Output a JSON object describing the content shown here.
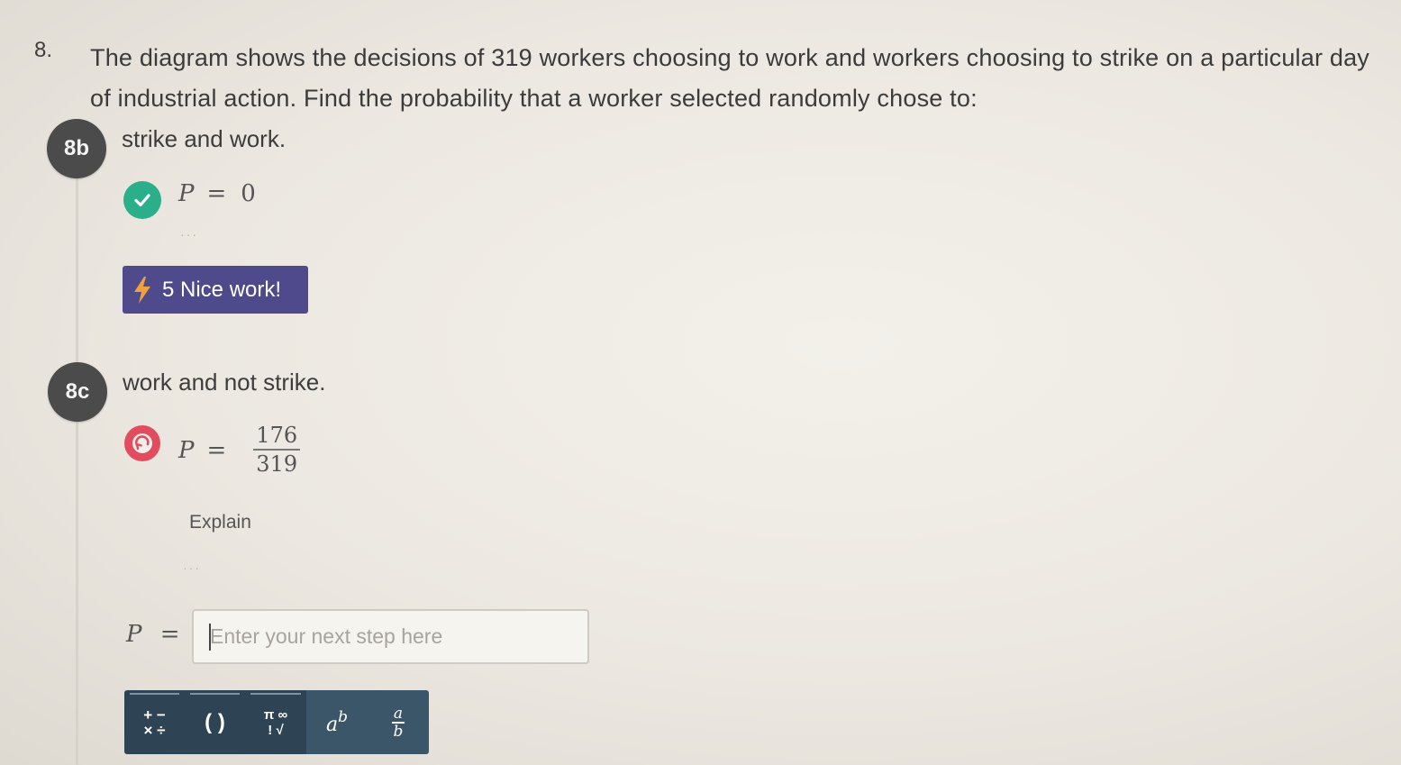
{
  "question": {
    "number": "8.",
    "text": "The diagram shows the decisions of 319 workers choosing to work and workers choosing to strike on a particular day of industrial action. Find the probability that a worker selected randomly chose to:"
  },
  "part_b": {
    "badge": "8b",
    "prompt": "strike and work.",
    "answer_var": "P",
    "answer_eq": "=",
    "answer_value": "0",
    "status_icon": "check-icon",
    "more_dots": "···",
    "reward": {
      "icon": "lightning-icon",
      "label": "5 Nice work!"
    }
  },
  "part_c": {
    "badge": "8c",
    "prompt": "work and not strike.",
    "status_icon": "retry-icon",
    "answer_var": "P",
    "answer_eq": "=",
    "fraction": {
      "numerator": "176",
      "denominator": "319"
    },
    "explain_label": "Explain",
    "more_dots": "···",
    "input": {
      "label_var": "P",
      "label_eq": "=",
      "placeholder": "Enter your next step here",
      "value": ""
    }
  },
  "toolbar": {
    "tools": [
      {
        "name": "operators",
        "icon": "operators-icon",
        "top": "+ −",
        "bottom": "× ÷"
      },
      {
        "name": "brackets",
        "icon": "brackets-icon",
        "label": "( )"
      },
      {
        "name": "symbols",
        "icon": "symbols-icon",
        "top": "π ∞",
        "bottom": "! √"
      },
      {
        "name": "power",
        "icon": "power-icon",
        "base": "a",
        "exp": "b"
      },
      {
        "name": "fraction",
        "icon": "fraction-icon",
        "num": "a",
        "den": "b"
      }
    ]
  },
  "colors": {
    "badge": "#4b4b4b",
    "check": "#2bae8a",
    "retry": "#e24c5f",
    "reward_bg": "#4e4a8c",
    "toolbar": "#2e4455"
  }
}
